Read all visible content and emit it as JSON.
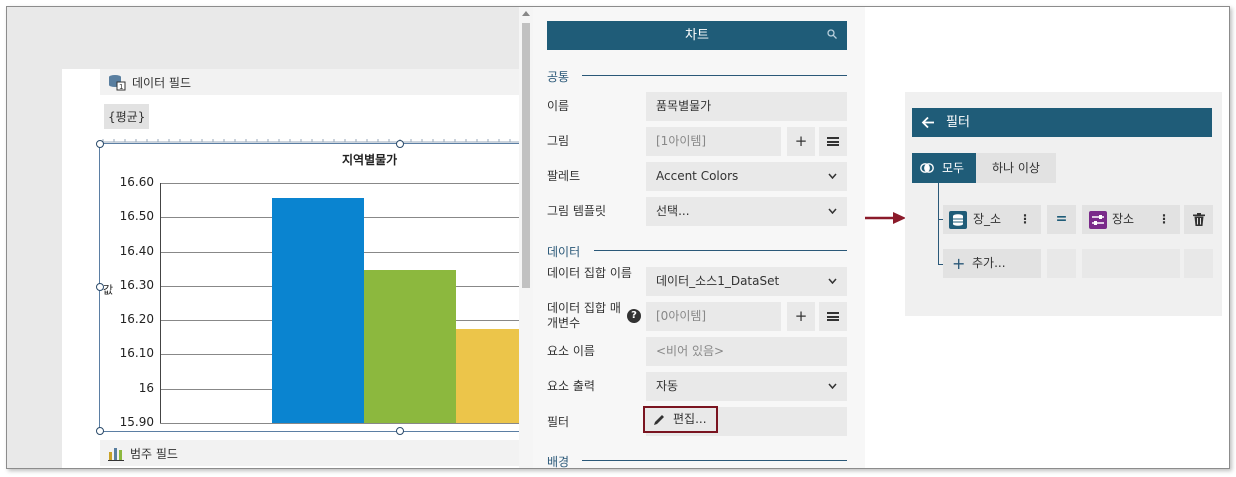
{
  "report": {
    "data_field_label": "데이터 필드",
    "data_chip": "{평균}",
    "category_field_label": "범주 필드",
    "chart": {
      "title": "지역별물가",
      "y_axis_label": "값"
    }
  },
  "chart_data": {
    "type": "bar",
    "title": "지역별물가",
    "ylabel": "값",
    "ylim": [
      15.9,
      16.6
    ],
    "yticks": [
      "16.60",
      "16.50",
      "16.40",
      "16.30",
      "16.20",
      "16.10",
      "16",
      "15.90"
    ],
    "series": [
      {
        "values": [
          16.555
        ],
        "color": "#0a84d0"
      },
      {
        "values": [
          16.345
        ],
        "color": "#8cb83e"
      },
      {
        "values": [
          16.175
        ],
        "color": "#ecc54a"
      }
    ],
    "grid": true
  },
  "properties": {
    "header": "차트",
    "section_general": "공통",
    "name_label": "이름",
    "name_value": "품목별물가",
    "image_label": "그림",
    "image_value": "[1아이템]",
    "palette_label": "팔레트",
    "palette_value": "Accent Colors",
    "image_template_label": "그림 템플릿",
    "image_template_value": "선택...",
    "section_data": "데이터",
    "dataset_name_label": "데이터 집합 이름",
    "dataset_name_value": "데이터_소스1_DataSet",
    "dataset_param_label": "데이터 집합 매개변수",
    "dataset_param_value": "[0아이템]",
    "element_name_label": "요소 이름",
    "element_name_placeholder": "<비어 있음>",
    "element_output_label": "요소 출력",
    "element_output_value": "자동",
    "filter_label": "필터",
    "filter_button": "편집...",
    "section_background": "배경"
  },
  "filter_panel": {
    "title": "필터",
    "mode_all": "모두",
    "mode_any": "하나 이상",
    "left_field": "장_소",
    "operator": "=",
    "right_field": "장소",
    "add_label": "추가..."
  },
  "colors": {
    "header": "#1f5c78",
    "highlight_border": "#7a1420",
    "arrow": "#8b1a2a"
  }
}
